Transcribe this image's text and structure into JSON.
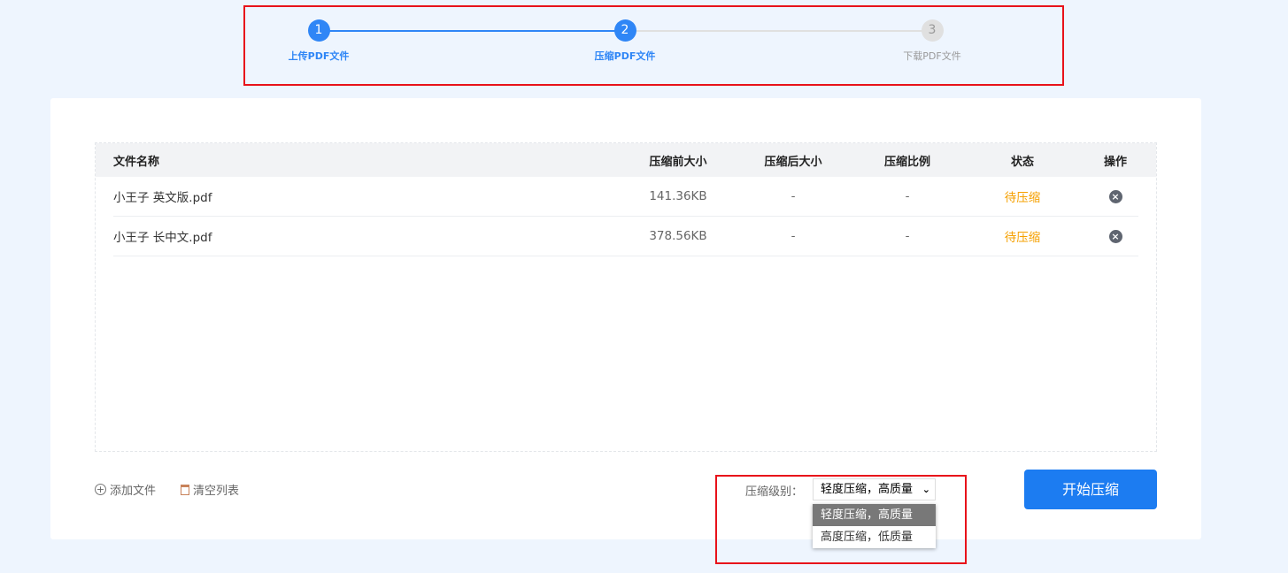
{
  "steps": [
    {
      "num": "1",
      "label": "上传PDF文件"
    },
    {
      "num": "2",
      "label": "压缩PDF文件"
    },
    {
      "num": "3",
      "label": "下载PDF文件"
    }
  ],
  "table": {
    "headers": [
      "文件名称",
      "压缩前大小",
      "压缩后大小",
      "压缩比例",
      "状态",
      "操作"
    ],
    "rows": [
      {
        "name": "小王子 英文版.pdf",
        "before": "141.36KB",
        "after": "-",
        "ratio": "-",
        "status": "待压缩"
      },
      {
        "name": "小王子 长中文.pdf",
        "before": "378.56KB",
        "after": "-",
        "ratio": "-",
        "status": "待压缩"
      }
    ]
  },
  "toolbar": {
    "add": "添加文件",
    "clear": "清空列表",
    "level_label": "压缩级别：",
    "selected": "轻度压缩，高质量",
    "options": [
      "轻度压缩，高质量",
      "高度压缩，低质量"
    ],
    "start": "开始压缩"
  },
  "colors": {
    "accent": "#1c7cf1",
    "pending": "#f5a000"
  }
}
